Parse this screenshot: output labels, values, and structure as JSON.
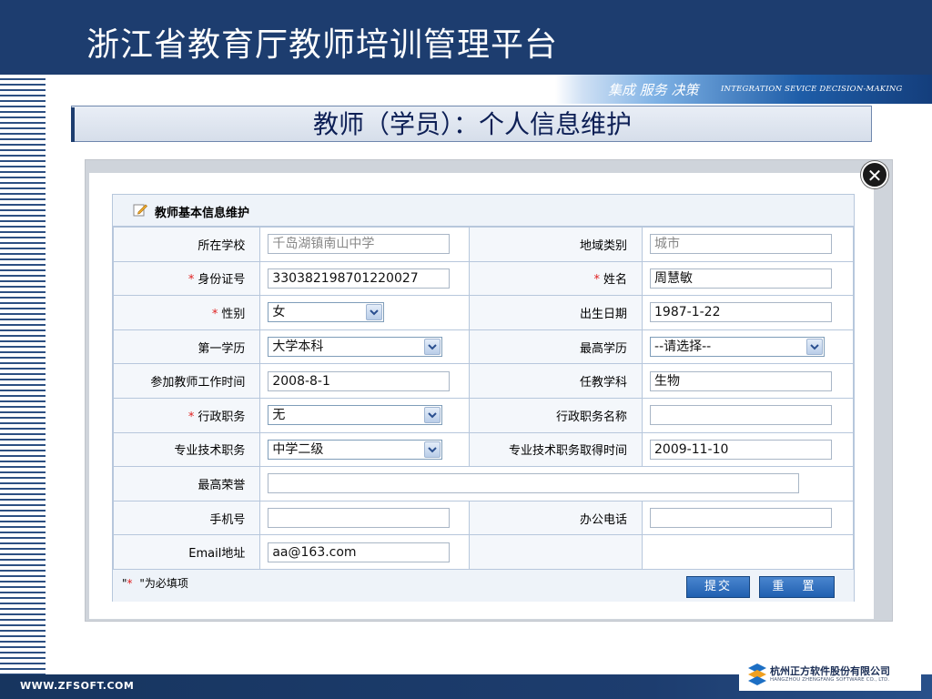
{
  "slide": {
    "title": "浙江省教育厅教师培训管理平台",
    "slogan_cn": "集成 服务 决策",
    "slogan_en": "INTEGRATION SEVICE DECISION-MAKING",
    "section_title": "教师（学员）：个人信息维护",
    "website": "WWW.ZFSOFT.COM",
    "company_cn": "杭州正方软件股份有限公司",
    "company_en": "HANGZHOU ZHENGFANG SOFTWARE CO., LTD."
  },
  "form": {
    "title": "教师基本信息维护",
    "rows": [
      {
        "l1": "所在学校",
        "v1": "千岛湖镇南山中学",
        "l2": "地域类别",
        "v2": "城市"
      },
      {
        "l1": "身份证号",
        "v1": "330382198701220027",
        "l2": "姓名",
        "v2": "周慧敏"
      },
      {
        "l1": "性别",
        "v1": "女",
        "l2": "出生日期",
        "v2": "1987-1-22"
      },
      {
        "l1": "第一学历",
        "v1": "大学本科",
        "l2": "最高学历",
        "v2": "--请选择--"
      },
      {
        "l1": "参加教师工作时间",
        "v1": "2008-8-1",
        "l2": "任教学科",
        "v2": "生物"
      },
      {
        "l1": "行政职务",
        "v1": "无",
        "l2": "行政职务名称",
        "v2": ""
      },
      {
        "l1": "专业技术职务",
        "v1": "中学二级",
        "l2": "专业技术职务取得时间",
        "v2": "2009-11-10"
      },
      {
        "l1": "最高荣誉",
        "v1": ""
      },
      {
        "l1": "手机号",
        "v1": "",
        "l2": "办公电话",
        "v2": ""
      },
      {
        "l1": "Email地址",
        "v1": "aa@163.com"
      }
    ],
    "required_mark": "*",
    "required_note_prefix": "\"",
    "required_note_suffix": " \"为必填项",
    "submit_label": "提交",
    "reset_label": "重 置"
  },
  "colors": {
    "header_bg": "#1d3d6f",
    "required": "#e02020",
    "button": "#1f5fb0"
  }
}
